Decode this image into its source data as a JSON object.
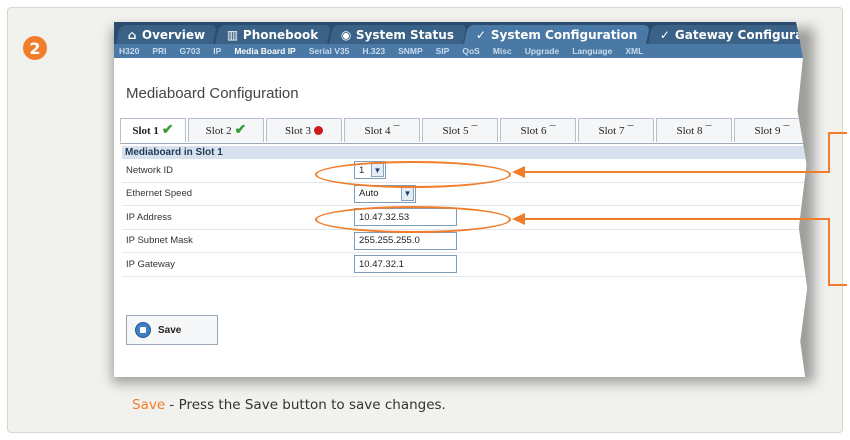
{
  "step_number": "2",
  "tabs": [
    {
      "icon": "home-icon",
      "label": "Overview"
    },
    {
      "icon": "phonebook-icon",
      "label": "Phonebook"
    },
    {
      "icon": "status-icon",
      "label": "System Status"
    },
    {
      "icon": "wrench-icon",
      "label": "System Configuration",
      "active": true
    },
    {
      "icon": "wrench-icon",
      "label": "Gateway Configuration"
    }
  ],
  "subnav": [
    "H320",
    "PRI",
    "G703",
    "IP",
    "Media Board IP",
    "Serial V35",
    "H.323",
    "SNMP",
    "SIP",
    "QoS",
    "Misc",
    "Upgrade",
    "Language",
    "XML"
  ],
  "subnav_active": "Media Board IP",
  "page_title": "Mediaboard Configuration",
  "slots": [
    {
      "label": "Slot 1",
      "status": "check"
    },
    {
      "label": "Slot 2",
      "status": "check"
    },
    {
      "label": "Slot 3",
      "status": "error"
    },
    {
      "label": "Slot 4",
      "status": "none"
    },
    {
      "label": "Slot 5",
      "status": "none"
    },
    {
      "label": "Slot 6",
      "status": "none"
    },
    {
      "label": "Slot 7",
      "status": "none"
    },
    {
      "label": "Slot 8",
      "status": "none"
    },
    {
      "label": "Slot 9",
      "status": "none"
    }
  ],
  "section_title": "Mediaboard in Slot 1",
  "fields": {
    "network_id": {
      "label": "Network ID",
      "value": "1"
    },
    "ethernet_speed": {
      "label": "Ethernet Speed",
      "value": "Auto"
    },
    "ip_address": {
      "label": "IP Address",
      "value": "10.47.32.53"
    },
    "subnet_mask": {
      "label": "IP Subnet Mask",
      "value": "255.255.255.0"
    },
    "gateway": {
      "label": "IP Gateway",
      "value": "10.47.32.1"
    }
  },
  "save_label": "Save",
  "caption": {
    "key": "Save",
    "text": " - Press the Save button to save changes."
  },
  "colors": {
    "accent": "#ef7d2b",
    "nav": "#2b4c6e",
    "subnav": "#4a79a5"
  }
}
